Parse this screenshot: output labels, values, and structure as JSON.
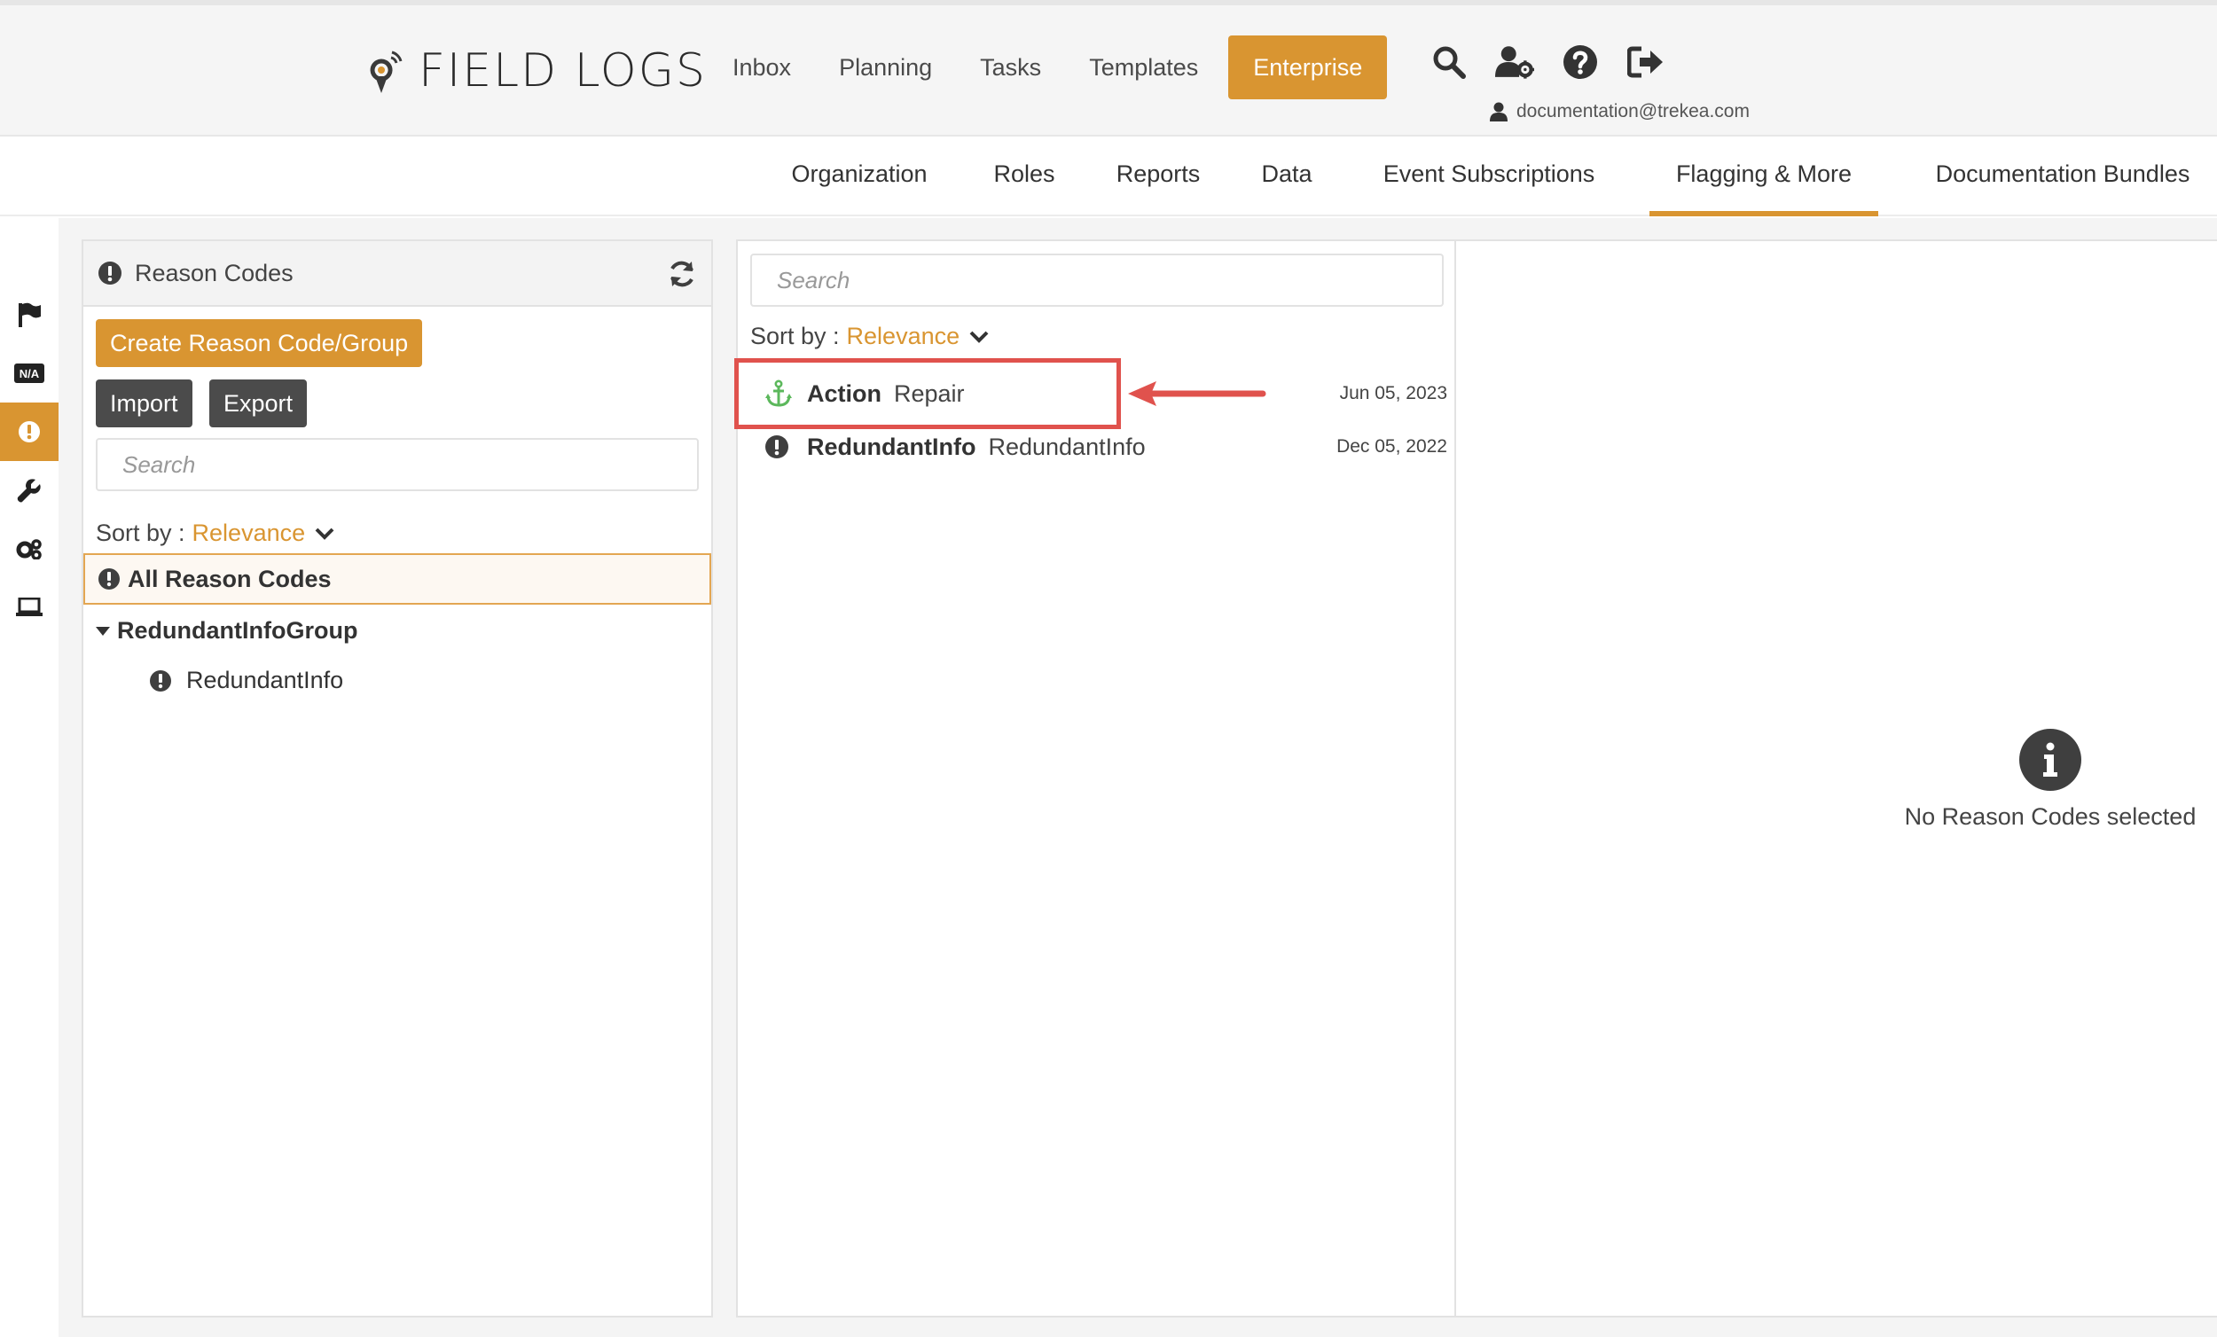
{
  "header": {
    "logo_text": "FIELD LOGS",
    "nav": [
      "Inbox",
      "Planning",
      "Tasks",
      "Templates",
      "Enterprise"
    ],
    "active_nav": "Enterprise",
    "user_email": "documentation@trekea.com",
    "icons": [
      "search-icon",
      "user-settings-icon",
      "help-icon",
      "logout-icon"
    ]
  },
  "subnav": {
    "items": [
      "Organization",
      "Roles",
      "Reports",
      "Data",
      "Event Subscriptions",
      "Flagging & More",
      "Documentation Bundles"
    ],
    "active": "Flagging & More"
  },
  "rail": {
    "icons": [
      "flag-icon",
      "na-icon",
      "exclamation-icon",
      "wrench-icon",
      "gears-icon",
      "laptop-icon"
    ],
    "na_text": "N/A",
    "active": "exclamation-icon"
  },
  "left_panel": {
    "title": "Reason Codes",
    "create_button": "Create Reason Code/Group",
    "import_button": "Import",
    "export_button": "Export",
    "search_placeholder": "Search",
    "sort_label": "Sort by :",
    "sort_value": "Relevance",
    "tree": {
      "all": "All Reason Codes",
      "group": "RedundantInfoGroup",
      "leaf": "RedundantInfo"
    }
  },
  "middle_panel": {
    "search_placeholder": "Search",
    "sort_label": "Sort by :",
    "sort_value": "Relevance",
    "items": [
      {
        "name": "Action",
        "description": "Repair",
        "date": "Jun 05, 2023",
        "icon": "anchor-icon"
      },
      {
        "name": "RedundantInfo",
        "description": "RedundantInfo",
        "date": "Dec 05, 2022",
        "icon": "exclamation-icon"
      }
    ]
  },
  "right_panel": {
    "empty_message": "No Reason Codes selected"
  },
  "colors": {
    "accent": "#d99531",
    "annotation": "#e0524d",
    "anchor_green": "#5cb85c",
    "dark_button": "#4b4b4b"
  }
}
